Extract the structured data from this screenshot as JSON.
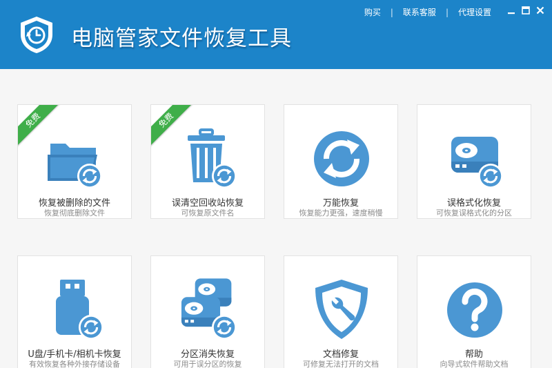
{
  "header": {
    "title": "电脑管家文件恢复工具",
    "links": [
      "购买",
      "联系客服",
      "代理设置"
    ],
    "separator": "|"
  },
  "colors": {
    "header_bg": "#1c84c9",
    "icon_blue": "#4b97d3",
    "badge_green": "#3fae49"
  },
  "tiles": [
    {
      "title": "恢复被删除的文件",
      "desc": "恢复彻底删除文件",
      "badge": "免费",
      "icon": "folder-restore-icon"
    },
    {
      "title": "误清空回收站恢复",
      "desc": "可恢复原文件名",
      "badge": "免费",
      "icon": "trash-restore-icon"
    },
    {
      "title": "万能恢复",
      "desc": "恢复能力更强，速度稍慢",
      "icon": "universal-restore-icon"
    },
    {
      "title": "误格式化恢复",
      "desc": "可恢复误格式化的分区",
      "icon": "disk-restore-icon"
    },
    {
      "title": "U盘/手机卡/相机卡恢复",
      "desc": "有效恢复各种外接存储设备",
      "icon": "usb-restore-icon"
    },
    {
      "title": "分区消失恢复",
      "desc": "可用于误分区的恢复",
      "icon": "partition-restore-icon"
    },
    {
      "title": "文档修复",
      "desc": "可修复无法打开的文档",
      "icon": "document-repair-icon"
    },
    {
      "title": "帮助",
      "desc": "向导式软件帮助文档",
      "icon": "help-icon"
    }
  ]
}
